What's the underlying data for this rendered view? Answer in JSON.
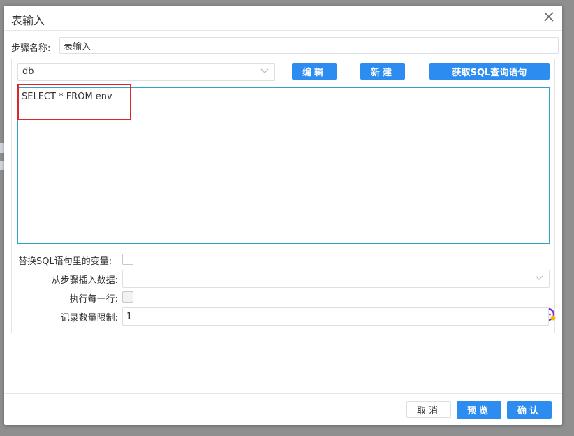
{
  "dialog": {
    "title": "表输入"
  },
  "step": {
    "label": "步骤名称:",
    "value": "表输入"
  },
  "connection": {
    "selected": "db"
  },
  "toolbar": {
    "edit_label": "编辑",
    "new_label": "新建",
    "get_sql_label": "获取SQL查询语句"
  },
  "editor": {
    "sql": "SELECT * FROM env"
  },
  "options": {
    "replace_vars_label": "替换SQL语句里的变量:",
    "insert_from_step_label": "从步骤插入数据:",
    "insert_from_step_value": "",
    "execute_each_row_label": "执行每一行:",
    "limit_label": "记录数量限制:",
    "limit_value": "1"
  },
  "footer": {
    "cancel_label": "取消",
    "preview_label": "预览",
    "confirm_label": "确认"
  },
  "colors": {
    "primary": "#2c8cf0",
    "highlight": "#e0242c",
    "editor_border": "#2fa3c7"
  }
}
